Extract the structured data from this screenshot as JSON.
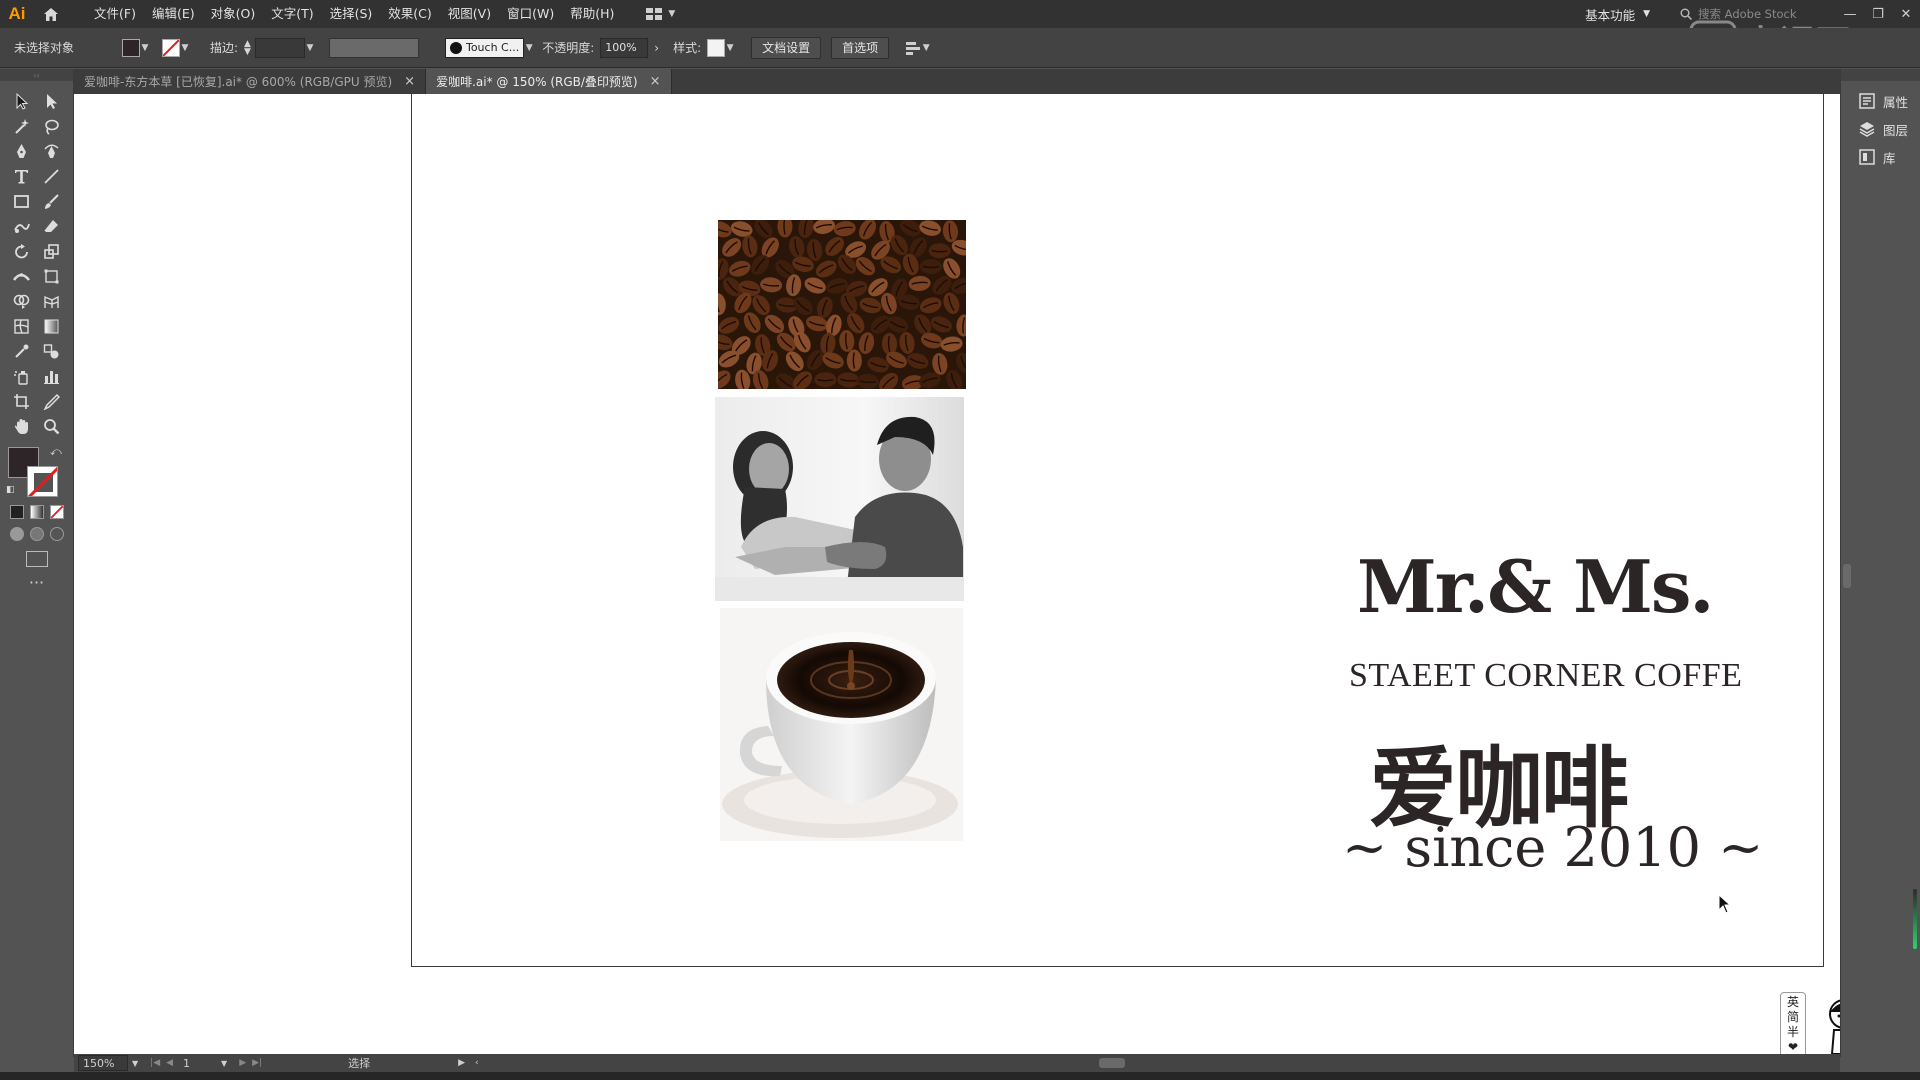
{
  "app": {
    "logo": "Ai",
    "menus": [
      "文件(F)",
      "编辑(E)",
      "对象(O)",
      "文字(T)",
      "选择(S)",
      "效果(C)",
      "视图(V)",
      "窗口(W)",
      "帮助(H)"
    ],
    "workspace": "基本功能",
    "search_placeholder": "搜索 Adobe Stock"
  },
  "control_bar": {
    "selection_status": "未选择对象",
    "stroke_label": "描边:",
    "brush_label": "Touch C...",
    "opacity_label": "不透明度:",
    "opacity_value": "100%",
    "style_label": "样式:",
    "doc_setup_button": "文档设置",
    "preferences_button": "首选项"
  },
  "tabs": [
    {
      "label": "爱咖啡-东方本草 [已恢复].ai* @ 600% (RGB/GPU 预览)",
      "active": false
    },
    {
      "label": "爱咖啡.ai* @ 150% (RGB/叠印预览)",
      "active": true
    }
  ],
  "right_panels": [
    {
      "label": "属性",
      "icon": "properties-icon"
    },
    {
      "label": "图层",
      "icon": "layers-icon"
    },
    {
      "label": "库",
      "icon": "libraries-icon"
    }
  ],
  "artboard": {
    "title_en": "Mr.& Ms.",
    "subtitle_en": "STAEET CORNER COFFE",
    "title_cn": "爱咖啡",
    "since": "~ since 2010 ~",
    "images": [
      "coffee-beans-photo",
      "couple-photo",
      "coffee-cup-photo"
    ]
  },
  "status_bar": {
    "zoom": "150%",
    "artboard_number": "1",
    "tool_name": "选择"
  },
  "sticker": {
    "chars": [
      "英",
      "简",
      "半",
      "❤"
    ]
  },
  "colors": {
    "ui_dark": "#323232",
    "ui_mid": "#535353",
    "brand_text": "#2c2526",
    "ai_orange": "#ff9a00"
  }
}
